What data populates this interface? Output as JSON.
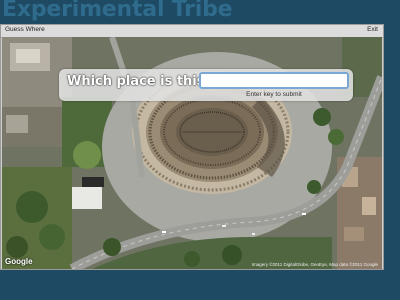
{
  "background": {
    "app_title": "Experimental Tribe"
  },
  "window": {
    "title": "Guess Where",
    "exit_label": "Exit"
  },
  "quiz": {
    "question": "Which place is this?",
    "answer_value": "",
    "answer_placeholder": "",
    "hint": "Enter key to submit"
  },
  "map": {
    "provider_logo": "Google",
    "copyright": "Imagery ©2011 DigitalGlobe, GeoEye, Map data ©2011 Google"
  },
  "colors": {
    "page_background": "#1f4a63",
    "input_border": "#79a8d6"
  }
}
